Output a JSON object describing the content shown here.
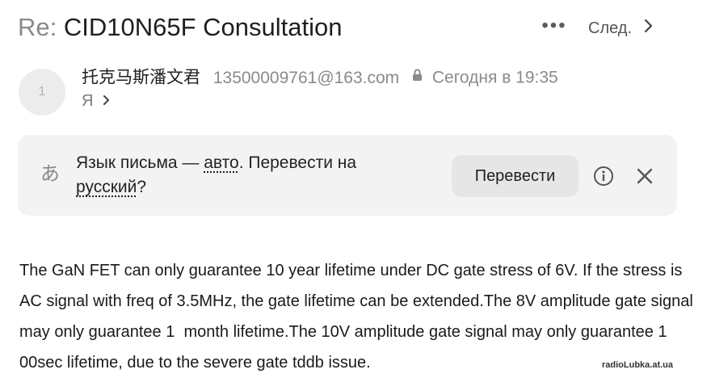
{
  "header": {
    "subject_prefix": "Re:",
    "subject": "CID10N65F Consultation",
    "more_label": "•••",
    "next_label": "След."
  },
  "sender": {
    "avatar_initial": "1",
    "name": "托克马斯潘文君",
    "email": "13500009761@163.com",
    "time": "Сегодня в 19:35",
    "recipient": "Я"
  },
  "translate": {
    "text_before": "Язык письма — ",
    "detected_lang": "авто",
    "text_middle": ". Перевести на ",
    "target_lang": "русский",
    "text_after": "?",
    "button_label": "Перевести",
    "lang_icon_glyph": "あ"
  },
  "message": {
    "body": "The GaN FET can only guarantee 10 year lifetime under DC gate stress of 6V. If the stress is AC signal with freq of 3.5MHz, the gate lifetime can be extended.The 8V amplitude gate signal may only guarantee 1  month lifetime.The 10V amplitude gate signal may only guarantee 1 00sec lifetime, due to the severe gate tddb issue."
  },
  "watermark": "radioLubka.at.ua",
  "colors": {
    "bar_background": "#f3f3f4",
    "button_background": "#e6e6e7",
    "muted_text": "#8a8a8a"
  }
}
